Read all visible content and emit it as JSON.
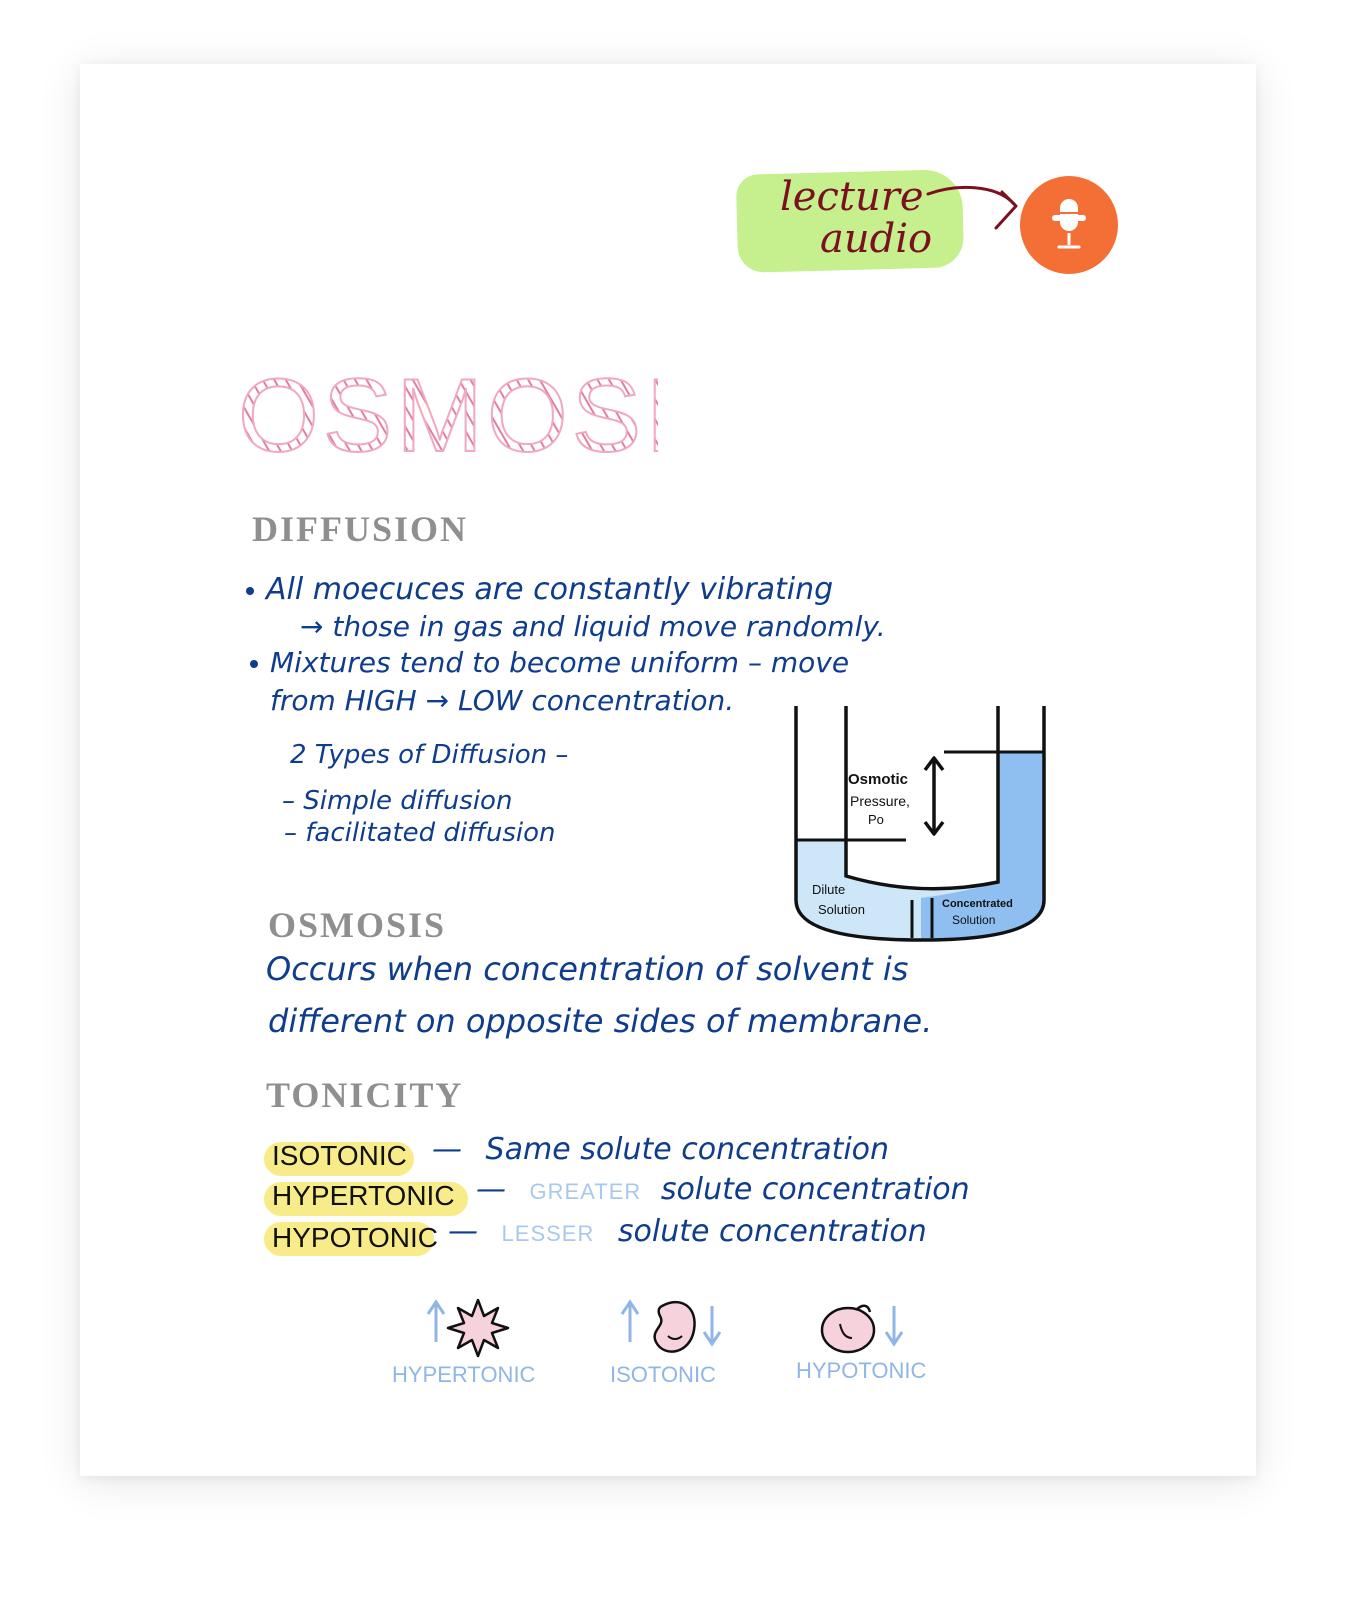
{
  "lecture_audio": {
    "line1": "lecture",
    "line2": "audio",
    "icon": "microphone-icon",
    "button_color": "#f46f36",
    "highlight_color": "#c6f08e"
  },
  "title": "OSMOSIS",
  "diffusion": {
    "heading": "DIFFUSION",
    "bullet1": "All moecuces are constantly vibrating",
    "bullet1_sub": "→ those in gas and liquid move randomly.",
    "bullet2_line1": "Mixtures tend to become uniform – move",
    "bullet2_line2": "from HIGH → LOW concentration.",
    "types_heading": "2 Types of Diffusion –",
    "types": [
      "– Simple diffusion",
      "– facilitated diffusion"
    ]
  },
  "diagram": {
    "pressure_label_1": "Osmotic",
    "pressure_label_2": "Pressure,",
    "pressure_label_3": "Po",
    "dilute_1": "Dilute",
    "dilute_2": "Solution",
    "conc_1": "Concentrated",
    "conc_2": "Solution"
  },
  "osmosis": {
    "heading": "OSMOSIS",
    "line1": "Occurs when concentration of solvent is",
    "line2": "different on opposite sides of membrane."
  },
  "tonicity": {
    "heading": "TONICITY",
    "rows": [
      {
        "label": "ISOTONIC",
        "dash": "—",
        "modifier": "",
        "text": "Same solute concentration"
      },
      {
        "label": "HYPERTONIC",
        "dash": "—",
        "modifier": "GREATER",
        "text": "solute concentration"
      },
      {
        "label": "HYPOTONIC",
        "dash": "—",
        "modifier": "LESSER",
        "text": "solute concentration"
      }
    ],
    "cells": [
      {
        "label": "HYPERTONIC"
      },
      {
        "label": "ISOTONIC"
      },
      {
        "label": "HYPOTONIC"
      }
    ]
  },
  "colors": {
    "ink": "#0f3c8c",
    "title_pink": "#f2a8bd",
    "heading_gray": "#8f8f8f",
    "tonicity_highlight": "#f8ec8a",
    "soft_blue": "#a8c8ee",
    "dilute_fill": "#cde6f8",
    "concentrated_fill": "#8fbff0"
  }
}
